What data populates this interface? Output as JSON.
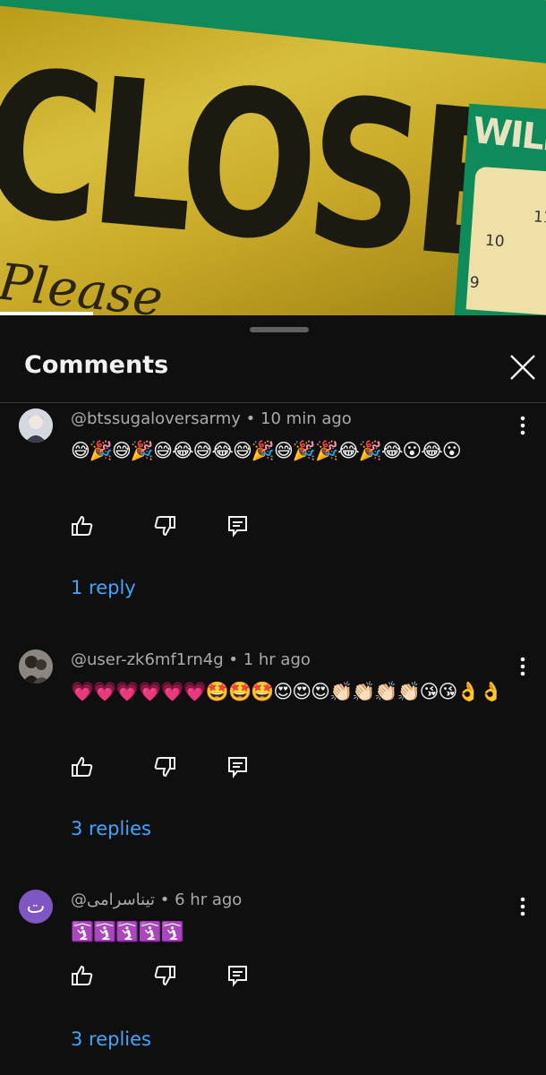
{
  "video": {
    "sign_word": "CLOSED",
    "sign_sub": "Please",
    "panel_word": "WILL",
    "clock_numbers": [
      "11",
      "10",
      "9"
    ],
    "progress_fraction": 0.17
  },
  "sheet": {
    "title": "Comments",
    "close_icon": "close-icon"
  },
  "comments": [
    {
      "author": "@btssugaloversarmy",
      "time": "10 min ago",
      "text": "😅🎉😅🎉😅😂😅😂😅🎉😅🎉🎉😂🎉😂😮😂😮",
      "replies": "1 reply",
      "avatar_color": "#c9ccd6"
    },
    {
      "author": "@user-zk6mf1rn4g",
      "time": "1 hr ago",
      "text": "💗💗💗💗💗💗🤩🤩🤩😍😍😍👏🏻👏🏻👏🏻👏🏻😘😘👌👌",
      "replies": "3 replies",
      "avatar_color": "#5a5a5a"
    },
    {
      "author": "@تیناسرامی",
      "time": "6 hr ago",
      "text": "🛐🛐🛐🛐🛐",
      "replies": "3 replies",
      "avatar_letter": "ت",
      "avatar_color": "#7e57c2"
    }
  ],
  "separator": "•"
}
